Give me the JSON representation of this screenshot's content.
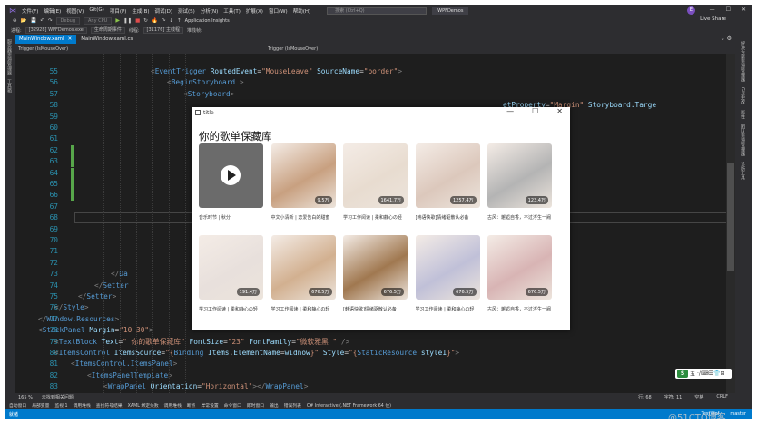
{
  "menu": {
    "items": [
      "文件(F)",
      "编辑(E)",
      "视图(V)",
      "Git(G)",
      "项目(P)",
      "生成(B)",
      "调试(D)",
      "测试(S)",
      "分析(N)",
      "工具(T)",
      "扩展(X)",
      "窗口(W)",
      "帮助(H)"
    ],
    "search_placeholder": "搜索 (Ctrl+Q)",
    "solution": "WPFDemos",
    "avatar": "E",
    "live_share": "Live Share"
  },
  "toolbar": {
    "config": "Debug",
    "platform": "Any CPU",
    "insights": "Application Insights"
  },
  "procbar": {
    "process_label": "进程:",
    "process": "[32928] WPFDemos.exe",
    "lifecycle": "生命周期事件",
    "thread_label": "线程:",
    "thread": "[31176] 主线程",
    "stack_label": "堆栈帧:"
  },
  "tabs": [
    {
      "label": "MainWindow.xaml",
      "active": true
    },
    {
      "label": "MainWindow.xaml.cs",
      "active": false
    }
  ],
  "navbar": {
    "left": "Trigger (IsMouseOver)",
    "right": "Trigger (IsMouseOver)"
  },
  "left_strip": [
    "服务器资源管理器",
    "工具箱"
  ],
  "right_strip": [
    "解决方案资源管理器",
    "Git 更改",
    "属性",
    "团队资源管理器",
    "诊断工具"
  ],
  "editor": {
    "lines": [
      {
        "n": "55",
        "segs": [
          [
            "t",
            "<"
          ],
          [
            "e",
            "EventTrigger "
          ],
          [
            "a",
            "RoutedEvent"
          ],
          [
            "d",
            "="
          ],
          [
            "s",
            "\"MouseLeave\" "
          ],
          [
            "a",
            "SourceName"
          ],
          [
            "d",
            "="
          ],
          [
            "s",
            "\"border\""
          ],
          [
            "t",
            ">"
          ]
        ],
        "indent": 150
      },
      {
        "n": "56",
        "segs": [
          [
            "t",
            "<"
          ],
          [
            "e",
            "BeginStoryboard "
          ],
          [
            "t",
            ">"
          ]
        ],
        "indent": 168
      },
      {
        "n": "57",
        "segs": [
          [
            "t",
            "<"
          ],
          [
            "e",
            "Storyboard"
          ],
          [
            "t",
            ">"
          ]
        ],
        "indent": 186
      },
      {
        "n": "58",
        "segs": [
          [
            "a",
            "etProperty"
          ],
          [
            "d",
            "="
          ],
          [
            "s",
            "\"Margin\" "
          ],
          [
            "a",
            "Storyboard.Targe"
          ]
        ],
        "indent": 538
      },
      {
        "n": "59",
        "segs": [],
        "indent": 0
      },
      {
        "n": "60",
        "segs": [],
        "indent": 0
      },
      {
        "n": "61",
        "segs": [],
        "indent": 0
      },
      {
        "n": "62",
        "segs": [],
        "indent": 0
      },
      {
        "n": "63",
        "segs": [],
        "indent": 0
      },
      {
        "n": "64",
        "segs": [],
        "indent": 0
      },
      {
        "n": "65",
        "segs": [],
        "indent": 0
      },
      {
        "n": "66",
        "segs": [],
        "indent": 0
      },
      {
        "n": "67",
        "segs": [],
        "indent": 0
      },
      {
        "n": "68",
        "segs": [],
        "indent": 0
      },
      {
        "n": "69",
        "segs": [],
        "indent": 0
      },
      {
        "n": "70",
        "segs": [],
        "indent": 0
      },
      {
        "n": "71",
        "segs": [],
        "indent": 0
      },
      {
        "n": "72",
        "segs": [],
        "indent": 0
      },
      {
        "n": "73",
        "segs": [
          [
            "t",
            "</"
          ],
          [
            "e",
            "Da"
          ]
        ],
        "indent": 106
      },
      {
        "n": "74",
        "segs": [
          [
            "t",
            "</"
          ],
          [
            "e",
            "Setter"
          ]
        ],
        "indent": 88
      },
      {
        "n": "75",
        "segs": [
          [
            "t",
            "</"
          ],
          [
            "e",
            "Setter"
          ],
          [
            "t",
            ">"
          ]
        ],
        "indent": 70
      },
      {
        "n": "76",
        "segs": [
          [
            "t",
            "</"
          ],
          [
            "e",
            "Style"
          ],
          [
            "t",
            ">"
          ]
        ],
        "indent": 44
      },
      {
        "n": "77",
        "segs": [
          [
            "t",
            "</"
          ],
          [
            "e",
            "Window.Resources"
          ],
          [
            "t",
            ">"
          ]
        ],
        "indent": 26
      },
      {
        "n": "78",
        "segs": [
          [
            "t",
            "<"
          ],
          [
            "e",
            "StackPanel "
          ],
          [
            "a",
            "Margin"
          ],
          [
            "d",
            "="
          ],
          [
            "s",
            "\"10 30\""
          ],
          [
            "t",
            ">"
          ]
        ],
        "indent": 26
      },
      {
        "n": "79",
        "segs": [
          [
            "t",
            "<"
          ],
          [
            "e",
            "TextBlock "
          ],
          [
            "a",
            "Text"
          ],
          [
            "d",
            "="
          ],
          [
            "s",
            "\" 你的歌单保藏库\" "
          ],
          [
            "a",
            "FontSize"
          ],
          [
            "d",
            "="
          ],
          [
            "s",
            "\"23\" "
          ],
          [
            "a",
            "FontFamily"
          ],
          [
            "d",
            "="
          ],
          [
            "s",
            "\"微软雅黑 \""
          ],
          [
            "t",
            " />"
          ]
        ],
        "indent": 44
      },
      {
        "n": "80",
        "segs": [
          [
            "t",
            "<"
          ],
          [
            "e",
            "ItemsControl "
          ],
          [
            "a",
            "ItemsSource"
          ],
          [
            "d",
            "="
          ],
          [
            "s",
            "\"{"
          ],
          [
            "e",
            "Binding "
          ],
          [
            "a",
            "Items"
          ],
          [
            "d",
            ","
          ],
          [
            "a",
            "ElementName"
          ],
          [
            "d",
            "="
          ],
          [
            "a",
            "widnow"
          ],
          [
            "s",
            "}\" "
          ],
          [
            "a",
            "Style"
          ],
          [
            "d",
            "="
          ],
          [
            "s",
            "\"{"
          ],
          [
            "e",
            "StaticResource "
          ],
          [
            "a",
            "style1"
          ],
          [
            "s",
            "}\""
          ],
          [
            "t",
            ">"
          ]
        ],
        "indent": 44
      },
      {
        "n": "81",
        "segs": [
          [
            "t",
            "<"
          ],
          [
            "e",
            "ItemsControl.ItemsPanel"
          ],
          [
            "t",
            ">"
          ]
        ],
        "indent": 62
      },
      {
        "n": "82",
        "segs": [
          [
            "t",
            "<"
          ],
          [
            "e",
            "ItemsPanelTemplate"
          ],
          [
            "t",
            ">"
          ]
        ],
        "indent": 80
      },
      {
        "n": "83",
        "segs": [
          [
            "t",
            "<"
          ],
          [
            "e",
            "WrapPanel "
          ],
          [
            "a",
            "Orientation"
          ],
          [
            "d",
            "="
          ],
          [
            "s",
            "\"Horizontal\""
          ],
          [
            "t",
            "></"
          ],
          [
            "e",
            "WrapPanel"
          ],
          [
            "t",
            ">"
          ]
        ],
        "indent": 98
      }
    ]
  },
  "ime": {
    "label": "五",
    "extra": "·/⌨☰👕⊞"
  },
  "zoom": {
    "level": "165 %",
    "issues": "未找到相关问题",
    "line": "行: 68",
    "char": "字符: 11",
    "spaces": "空格",
    "eol": "CRLF"
  },
  "bottom_tabs": [
    "自动窗口",
    "局部变量",
    "监视 1",
    "调用堆栈",
    "查找符号结果",
    "XAML 绑定失败",
    "调用堆栈",
    "断点",
    "异常设置",
    "命令窗口",
    "即时窗口",
    "输出",
    "错误列表",
    "C# Interactive (.NET Framework 64 位)"
  ],
  "status": {
    "left": "就绪",
    "repo": "TestWpf",
    "branch": "master"
  },
  "wpf": {
    "title": "title",
    "heading": "你的歌单保藏库",
    "cards": [
      {
        "caption": "音乐时节 | 秋分",
        "count": "",
        "color": "#6b6b6b",
        "play": true
      },
      {
        "caption": "中文小清新 | 恋爱告白的甜蜜",
        "count": "9.5万",
        "color": "#c8a080",
        "play": false
      },
      {
        "caption": "学习工作阅读 | 柔和静心の轻",
        "count": "1641.7万",
        "color": "#e8dcd0",
        "play": false
      },
      {
        "caption": "[韩语快歌]情绪驱散认必备",
        "count": "1257.4万",
        "color": "#dcc8bc",
        "play": false
      },
      {
        "caption": "古风：邂逅自香，不过浮生一阙",
        "count": "123.4万",
        "color": "#b4b4b4",
        "play": false
      },
      {
        "caption": "学习工作阅读 | 柔和静心の轻",
        "count": "191.4万",
        "color": "#e8e0dc",
        "play": false
      },
      {
        "caption": "学习工作阅读 | 柔和静心の轻",
        "count": "676.5万",
        "color": "#d2b090",
        "play": false
      },
      {
        "caption": "[韩语快歌]情绪驱散认必备",
        "count": "676.5万",
        "color": "#a07850",
        "play": false
      },
      {
        "caption": "学习工作阅读 | 柔和静心の轻",
        "count": "676.5万",
        "color": "#c0c0d8",
        "play": false
      },
      {
        "caption": "古风：邂逅自香，不过浮生一阙",
        "count": "676.5万",
        "color": "#d8b4b4",
        "play": false
      }
    ]
  },
  "watermark": "@51CTO博客"
}
